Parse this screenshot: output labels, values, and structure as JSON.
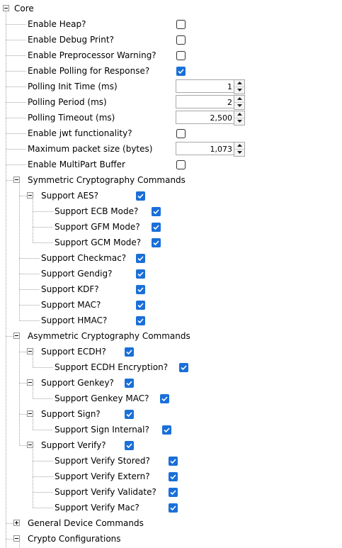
{
  "colors": {
    "check_fill": "#1a6fd8",
    "line": "#a0a0a0",
    "border": "#a9a9a9"
  },
  "root": {
    "label": "Core",
    "expander": "minus-icon"
  },
  "rows": [
    {
      "label": "Enable Heap?",
      "type": "checkbox",
      "checked": false
    },
    {
      "label": "Enable Debug Print?",
      "type": "checkbox",
      "checked": false
    },
    {
      "label": "Enable Preprocessor Warning?",
      "type": "checkbox",
      "checked": false
    },
    {
      "label": "Enable Polling for Response?",
      "type": "checkbox",
      "checked": true
    },
    {
      "label": "Polling Init Time (ms)",
      "type": "spinner",
      "value": "1"
    },
    {
      "label": "Polling Period (ms)",
      "type": "spinner",
      "value": "2"
    },
    {
      "label": "Polling Timeout (ms)",
      "type": "spinner",
      "value": "2,500"
    },
    {
      "label": "Enable jwt functionality?",
      "type": "checkbox",
      "checked": false
    },
    {
      "label": "Maximum packet size (bytes)",
      "type": "spinner",
      "value": "1,073"
    },
    {
      "label": "Enable MultiPart Buffer",
      "type": "checkbox",
      "checked": false
    },
    {
      "label": "Symmetric Cryptography Commands",
      "type": "group",
      "expanded": true
    },
    {
      "label": "Support AES?",
      "type": "checkbox",
      "checked": true,
      "expanded": true
    },
    {
      "label": "Support ECB Mode?",
      "type": "checkbox",
      "checked": true
    },
    {
      "label": "Support GFM Mode?",
      "type": "checkbox",
      "checked": true
    },
    {
      "label": "Support GCM Mode?",
      "type": "checkbox",
      "checked": true
    },
    {
      "label": "Support Checkmac?",
      "type": "checkbox",
      "checked": true
    },
    {
      "label": "Support Gendig?",
      "type": "checkbox",
      "checked": true
    },
    {
      "label": "Support KDF?",
      "type": "checkbox",
      "checked": true
    },
    {
      "label": "Support MAC?",
      "type": "checkbox",
      "checked": true
    },
    {
      "label": "Support HMAC?",
      "type": "checkbox",
      "checked": true
    },
    {
      "label": "Asymmetric Cryptography Commands",
      "type": "group",
      "expanded": true
    },
    {
      "label": "Support ECDH?",
      "type": "checkbox",
      "checked": true,
      "expanded": true
    },
    {
      "label": "Support ECDH Encryption?",
      "type": "checkbox",
      "checked": true
    },
    {
      "label": "Support Genkey?",
      "type": "checkbox",
      "checked": true,
      "expanded": true
    },
    {
      "label": "Support Genkey MAC?",
      "type": "checkbox",
      "checked": true
    },
    {
      "label": "Support Sign?",
      "type": "checkbox",
      "checked": true,
      "expanded": true
    },
    {
      "label": "Support Sign Internal?",
      "type": "checkbox",
      "checked": true
    },
    {
      "label": "Support Verify?",
      "type": "checkbox",
      "checked": true,
      "expanded": true
    },
    {
      "label": "Support Verify Stored?",
      "type": "checkbox",
      "checked": true
    },
    {
      "label": "Support Verify Extern?",
      "type": "checkbox",
      "checked": true
    },
    {
      "label": "Support Verify Validate?",
      "type": "checkbox",
      "checked": true
    },
    {
      "label": "Support Verify Mac?",
      "type": "checkbox",
      "checked": true
    },
    {
      "label": "General Device Commands",
      "type": "group",
      "expanded": false
    },
    {
      "label": "Crypto Configurations",
      "type": "group",
      "expanded": true
    }
  ]
}
